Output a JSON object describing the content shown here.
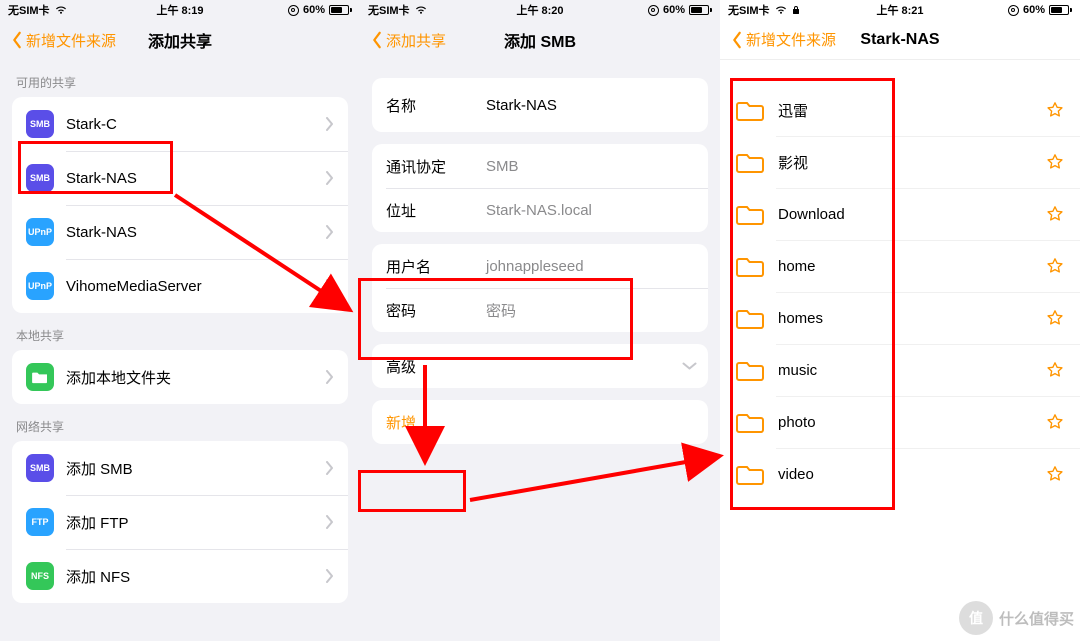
{
  "status": {
    "carrier": "无SIM卡",
    "battery_pct": "60%"
  },
  "pane1": {
    "time": "上午 8:19",
    "back": "新增文件来源",
    "title": "添加共享",
    "sec_available": "可用的共享",
    "shares": [
      {
        "type": "SMB",
        "label": "Stark-C",
        "color": "bg-purple"
      },
      {
        "type": "SMB",
        "label": "Stark-NAS",
        "color": "bg-purple"
      },
      {
        "type": "UPnP",
        "label": "Stark-NAS",
        "color": "bg-blue"
      },
      {
        "type": "UPnP",
        "label": "VihomeMediaServer",
        "color": "bg-blue"
      }
    ],
    "sec_local": "本地共享",
    "local_label": "添加本地文件夹",
    "sec_network": "网络共享",
    "network": [
      {
        "type": "SMB",
        "label": "添加 SMB",
        "color": "bg-purple"
      },
      {
        "type": "FTP",
        "label": "添加 FTP",
        "color": "bg-blue"
      },
      {
        "type": "NFS",
        "label": "添加 NFS",
        "color": "bg-green"
      }
    ]
  },
  "pane2": {
    "time": "上午 8:20",
    "back": "添加共享",
    "title": "添加 SMB",
    "name_label": "名称",
    "name_value": "Stark-NAS",
    "protocol_label": "通讯协定",
    "protocol_value": "SMB",
    "address_label": "位址",
    "address_value": "Stark-NAS.local",
    "user_label": "用户名",
    "user_placeholder": "johnappleseed",
    "pass_label": "密码",
    "pass_placeholder": "密码",
    "advanced": "高级",
    "add": "新增"
  },
  "pane3": {
    "time": "上午 8:21",
    "back": "新增文件来源",
    "title": "Stark-NAS",
    "folders": [
      "迅雷",
      "影视",
      "Download",
      "home",
      "homes",
      "music",
      "photo",
      "video"
    ]
  },
  "watermark": {
    "badge": "值",
    "text": "什么值得买"
  }
}
